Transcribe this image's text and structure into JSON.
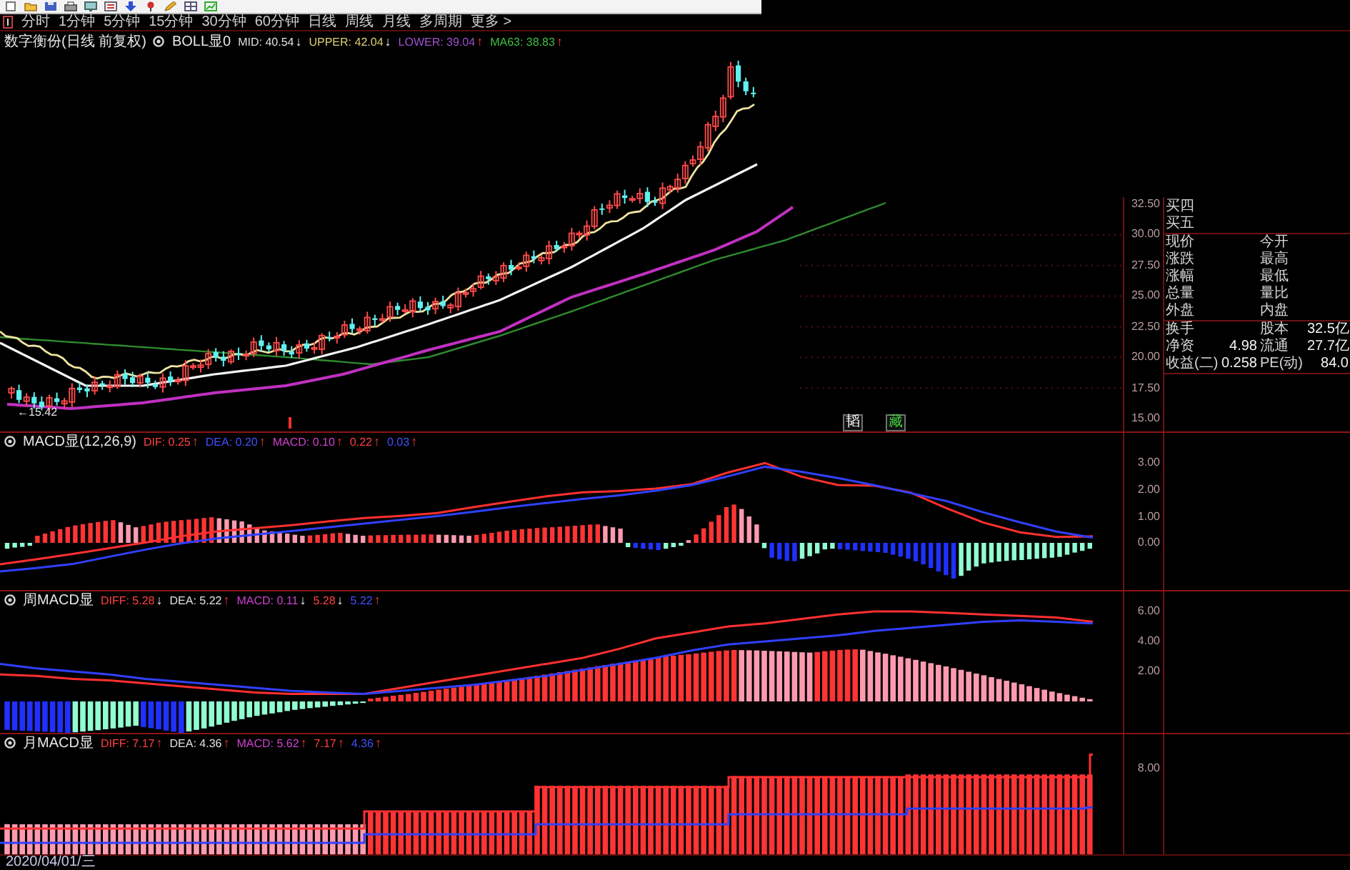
{
  "period_bar": {
    "items": [
      {
        "label": "分时"
      },
      {
        "label": "1分钟"
      },
      {
        "label": "5分钟"
      },
      {
        "label": "15分钟"
      },
      {
        "label": "30分钟"
      },
      {
        "label": "60分钟"
      },
      {
        "label": "日线"
      },
      {
        "label": "周线"
      },
      {
        "label": "月线"
      },
      {
        "label": "多周期"
      },
      {
        "label": "更多 >"
      }
    ]
  },
  "panels": [
    {
      "kind": "price",
      "title": "数字衡份(日线 前复权)",
      "indicator": "BOLL显0",
      "readings": [
        {
          "text": "MID: 40.54",
          "arrow": "↓",
          "rising": false,
          "color": "#e0e0e0"
        },
        {
          "text": "UPPER: 42.04",
          "arrow": "↓",
          "rising": false,
          "color": "#e0d070"
        },
        {
          "text": "LOWER: 39.04",
          "arrow": "↑",
          "rising": true,
          "color": "#a050d0"
        },
        {
          "text": "MA63: 38.83",
          "arrow": "↑",
          "rising": true,
          "color": "#40c040"
        }
      ],
      "low_marker": "←15.42",
      "signal_tags": [
        {
          "text": "韬",
          "color": "#ffffff"
        },
        {
          "text": "藏",
          "color": "#40d040"
        }
      ],
      "axis_ticks": [
        "32.50",
        "30.00",
        "27.50",
        "25.00",
        "22.50",
        "20.00",
        "17.50",
        "15.00"
      ]
    },
    {
      "kind": "macd",
      "indicator": "MACD显(12,26,9)",
      "readings": [
        {
          "text": "DIF: 0.25",
          "arrow": "↑",
          "rising": true,
          "color": "#ff4040"
        },
        {
          "text": "DEA: 0.20",
          "arrow": "↑",
          "rising": true,
          "color": "#4050ff"
        },
        {
          "text": "MACD: 0.10",
          "arrow": "↑",
          "rising": true,
          "color": "#d040d0"
        },
        {
          "text": "0.22",
          "arrow": "↑",
          "rising": true,
          "color": "#ff4040"
        },
        {
          "text": "0.03",
          "arrow": "↑",
          "rising": true,
          "color": "#4050ff"
        }
      ],
      "chart_data": {
        "type": "line",
        "ylim": [
          -1.78,
          3.51
        ],
        "yticks": [
          {
            "value": 3,
            "label": "3.00"
          },
          {
            "value": 2,
            "label": "2.00"
          },
          {
            "value": 1,
            "label": "1.00"
          },
          {
            "value": 0,
            "label": "0.00"
          }
        ],
        "series": [
          {
            "color": "#ff3030",
            "values": [
              -0.81,
              -0.62,
              -0.42,
              -0.2,
              0.02,
              0.26,
              0.44,
              0.56,
              0.67,
              0.81,
              0.94,
              1.02,
              1.13,
              1.35,
              1.56,
              1.76,
              1.91,
              1.96,
              2.05,
              2.22,
              2.67,
              3.02,
              2.5,
              2.19,
              2.16,
              1.9,
              1.3,
              0.77,
              0.4,
              0.22,
              0.25
            ]
          },
          {
            "color": "#3040ff",
            "values": [
              -1.08,
              -0.95,
              -0.8,
              -0.52,
              -0.25,
              -0.01,
              0.18,
              0.31,
              0.45,
              0.59,
              0.73,
              0.87,
              1.01,
              1.18,
              1.35,
              1.51,
              1.66,
              1.8,
              1.97,
              2.19,
              2.52,
              2.88,
              2.69,
              2.45,
              2.18,
              1.88,
              1.57,
              1.15,
              0.78,
              0.43,
              0.2
            ]
          }
        ]
      }
    },
    {
      "kind": "weekly_macd",
      "indicator": "周MACD显",
      "readings": [
        {
          "text": "DIFF: 5.28",
          "arrow": "↓",
          "rising": false,
          "color": "#ff4040"
        },
        {
          "text": "DEA: 5.22",
          "arrow": "↑",
          "rising": true,
          "color": "#e0e0e0"
        },
        {
          "text": "MACD: 0.11",
          "arrow": "↓",
          "rising": false,
          "color": "#d040d0"
        },
        {
          "text": "5.28",
          "arrow": "↓",
          "rising": false,
          "color": "#ff4040"
        },
        {
          "text": "5.22",
          "arrow": "↑",
          "rising": true,
          "color": "#4050ff"
        }
      ],
      "chart_data": {
        "type": "line",
        "ylim": [
          -2.1,
          6.19
        ],
        "yticks": [
          {
            "value": 6,
            "label": "6.00"
          },
          {
            "value": 4,
            "label": "4.00"
          },
          {
            "value": 2,
            "label": "2.00"
          }
        ],
        "series": [
          {
            "color": "#ff3030",
            "values": [
              1.8,
              1.7,
              1.5,
              1.4,
              1.2,
              1.0,
              0.8,
              0.6,
              0.5,
              0.5,
              0.5,
              0.9,
              1.3,
              1.7,
              2.1,
              2.5,
              2.9,
              3.5,
              4.2,
              4.6,
              5.0,
              5.2,
              5.5,
              5.8,
              6.0,
              6.0,
              5.9,
              5.8,
              5.7,
              5.6,
              5.3
            ]
          },
          {
            "color": "#3040ff",
            "values": [
              2.5,
              2.2,
              2.0,
              1.8,
              1.5,
              1.3,
              1.1,
              0.9,
              0.7,
              0.6,
              0.5,
              0.7,
              0.9,
              1.1,
              1.4,
              1.7,
              2.1,
              2.5,
              2.9,
              3.4,
              3.8,
              4.0,
              4.2,
              4.4,
              4.7,
              4.9,
              5.1,
              5.3,
              5.4,
              5.3,
              5.2
            ]
          }
        ]
      }
    },
    {
      "kind": "monthly_macd",
      "indicator": "月MACD显",
      "readings": [
        {
          "text": "DIFF: 7.17",
          "arrow": "↑",
          "rising": true,
          "color": "#ff4040"
        },
        {
          "text": "DEA: 4.36",
          "arrow": "↑",
          "rising": true,
          "color": "#e0e0e0"
        },
        {
          "text": "MACD: 5.62",
          "arrow": "↑",
          "rising": true,
          "color": "#d040d0"
        },
        {
          "text": "7.17",
          "arrow": "↑",
          "rising": true,
          "color": "#ff4040"
        },
        {
          "text": "4.36",
          "arrow": "↑",
          "rising": true,
          "color": "#4050ff"
        }
      ],
      "axis_ticks": [
        "8.00"
      ]
    }
  ],
  "quote_panel": {
    "order_book": [
      {
        "label": "买四"
      },
      {
        "label": "买五"
      }
    ],
    "quote_rows": [
      {
        "label": "现价",
        "label_2": "今开"
      },
      {
        "label": "涨跌",
        "label_2": "最高"
      },
      {
        "label": "涨幅",
        "label_2": "最低"
      },
      {
        "label": "总量",
        "label_2": "量比"
      },
      {
        "label": "外盘",
        "label_2": "内盘"
      }
    ],
    "stats_rows": [
      {
        "label": "换手",
        "label_2": "股本",
        "value_2": "32.5亿"
      },
      {
        "label": "净资",
        "value": "4.98",
        "label_2": "流通",
        "value_2": "27.7亿"
      },
      {
        "label": "收益(二)",
        "value": "0.258",
        "label_2": "PE(动)",
        "value_2": "84.0"
      }
    ]
  },
  "date_bar": {
    "text": "2020/04/01/三"
  }
}
